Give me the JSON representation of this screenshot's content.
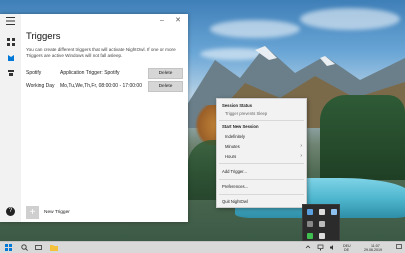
{
  "app": {
    "page_title": "Triggers",
    "description": "You can create different triggers that will activate NightOwl. If one or more Triggers are active Windows will not fall asleep.",
    "new_trigger_label": "New Trigger",
    "new_trigger_icon": "+",
    "help_icon_glyph": "?",
    "window_controls": {
      "minimize": "–",
      "close": "✕"
    },
    "triggers": [
      {
        "name": "Spotify",
        "detail": "Application Trigger: Spotify",
        "action": "Delete"
      },
      {
        "name": "Working Day",
        "detail": "Mo,Tu,We,Th,Fr, 08:00:00 - 17:00:00",
        "action": "Delete"
      }
    ],
    "rail_icons": [
      "hamburger-icon",
      "grid-icon",
      "owl-icon",
      "trigger-icon"
    ]
  },
  "menu": {
    "session_status_label": "Session Status",
    "session_status_value": "Trigger prevents Sleep",
    "start_label": "Start New Session",
    "indefinitely": "Indefinitely",
    "minutes": "Minutes",
    "hours": "Hours",
    "add_trigger": "Add Trigger...",
    "preferences": "Preferences...",
    "quit": "Quit NightOwl",
    "submenu_glyph": "›"
  },
  "taskbar": {
    "language": "DEU",
    "language_sub": "DE",
    "time": "11:07",
    "date": "29.06.2019"
  },
  "colors": {
    "accent": "#0078d7",
    "delete_button": "#d6d6d6"
  }
}
